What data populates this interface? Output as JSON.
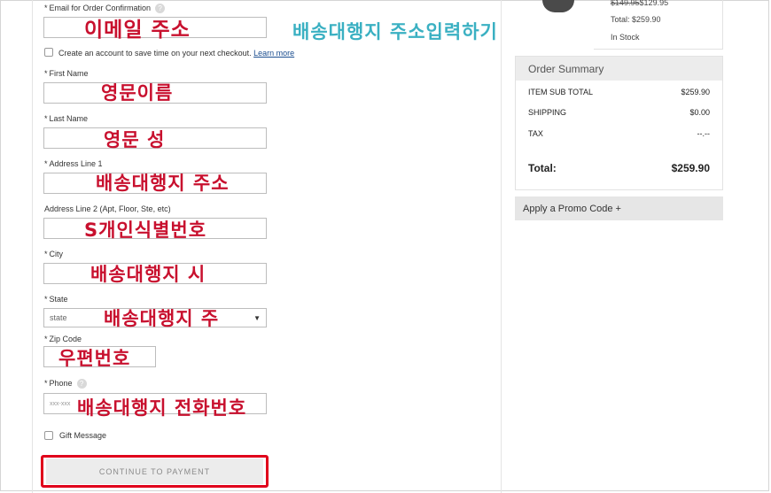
{
  "form": {
    "email": {
      "label": "Email for Order Confirmation",
      "annotation": "이메일 주소"
    },
    "create_account": {
      "label": "Create an account to save time on your next checkout.",
      "link": "Learn more"
    },
    "first_name": {
      "label": "First Name",
      "annotation": "영문이름"
    },
    "last_name": {
      "label": "Last Name",
      "annotation": "영문 성"
    },
    "address1": {
      "label": "Address Line 1",
      "annotation": "배송대행지 주소"
    },
    "address2": {
      "label": "Address Line 2 (Apt, Floor, Ste, etc)",
      "annotation": "S개인식별번호"
    },
    "city": {
      "label": "City",
      "annotation": "배송대행지 시"
    },
    "state": {
      "label": "State",
      "value": "state",
      "annotation": "배송대행지 주"
    },
    "zip": {
      "label": "Zip Code",
      "annotation": "우편번호"
    },
    "phone": {
      "label": "Phone",
      "placeholder": "xxx-xxx",
      "annotation": "배송대행지 전화번호"
    },
    "gift": {
      "label": "Gift Message"
    },
    "continue_label": "CONTINUE TO PAYMENT",
    "required_mark": "*",
    "help_glyph": "?"
  },
  "header_annotation": "배송대행지 주소입력하기",
  "product": {
    "price_old": "$149.95",
    "price_new": "$129.95",
    "total": "Total: $259.90",
    "stock": "In Stock"
  },
  "summary": {
    "title": "Order Summary",
    "rows": [
      {
        "label": "ITEM SUB TOTAL",
        "value": "$259.90"
      },
      {
        "label": "SHIPPING",
        "value": "$0.00"
      },
      {
        "label": "TAX",
        "value": "--.--"
      }
    ],
    "total_label": "Total:",
    "total_value": "$259.90"
  },
  "promo_label": "Apply a Promo Code +",
  "colors": {
    "annotation_red": "#c8102e",
    "annotation_teal": "#3ab0c2",
    "highlight_border": "#e0001b"
  }
}
